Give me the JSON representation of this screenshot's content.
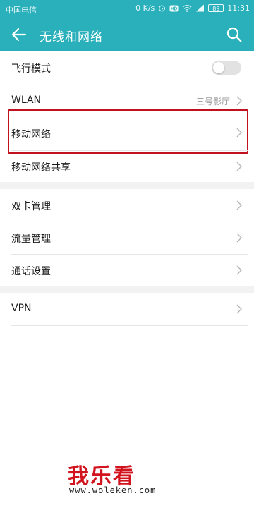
{
  "status_bar": {
    "carrier": "中国电信",
    "speed": "0 K/s",
    "battery": "89",
    "time": "11:31"
  },
  "app_bar": {
    "title": "无线和网络",
    "back_icon": "arrow-left-icon",
    "search_icon": "search-icon"
  },
  "settings": {
    "airplane_mode": {
      "label": "飞行模式",
      "enabled": false
    },
    "wlan": {
      "label": "WLAN",
      "value": "三号影厅"
    },
    "mobile_network": {
      "label": "移动网络",
      "highlighted": true
    },
    "mobile_network_sharing": {
      "label": "移动网络共享"
    },
    "dual_sim": {
      "label": "双卡管理"
    },
    "data_usage": {
      "label": "流量管理"
    },
    "call_settings": {
      "label": "通话设置"
    },
    "vpn": {
      "label": "VPN"
    }
  },
  "watermark": {
    "logo": "我乐看",
    "url": "www.woleken.com"
  },
  "colors": {
    "accent": "#2ab0bb",
    "highlight": "#c0111f",
    "watermark": "#d2141f"
  }
}
